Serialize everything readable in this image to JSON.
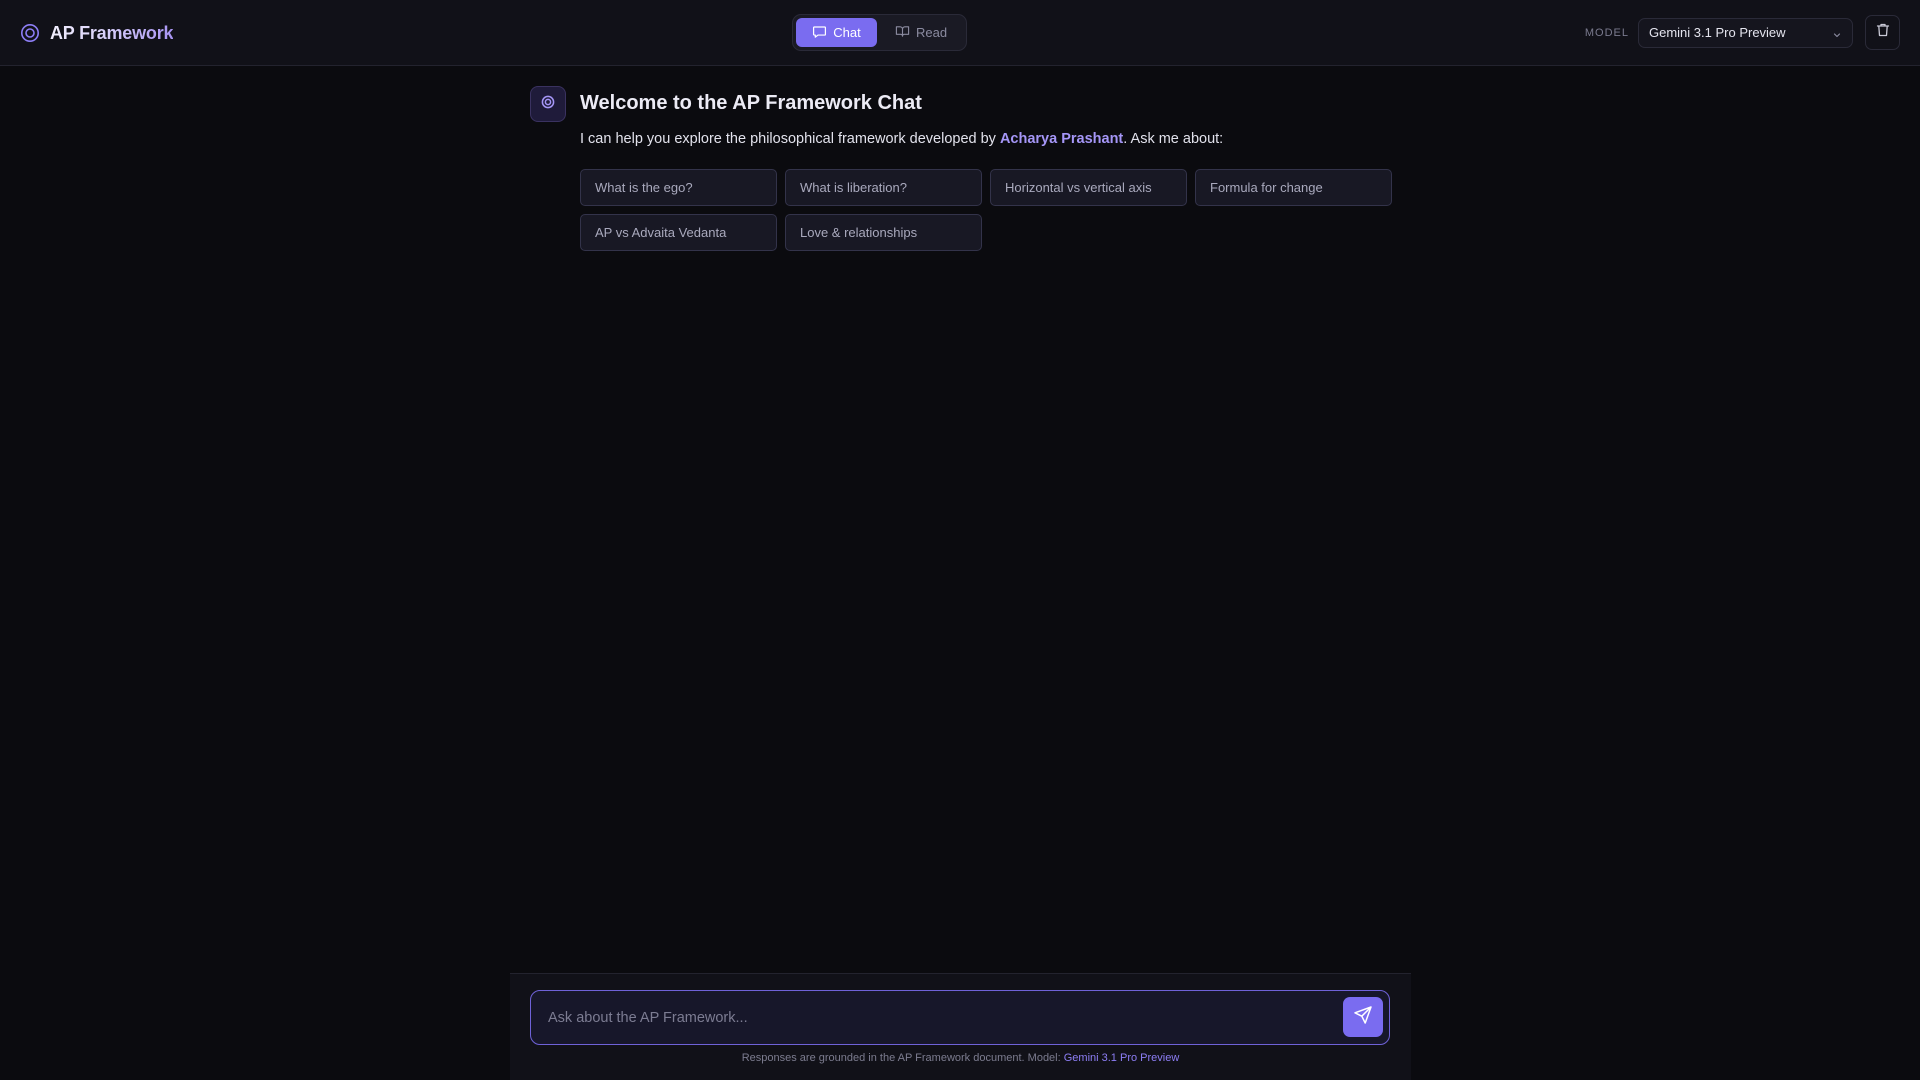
{
  "header": {
    "brand": {
      "title": "AP Framework",
      "icon": "target-circle-icon"
    },
    "mode_toggle": [
      {
        "label": "Chat",
        "icon": "chat-bubble-icon",
        "active": true
      },
      {
        "label": "Read",
        "icon": "book-open-icon",
        "active": false
      }
    ],
    "model_label": "MODEL",
    "model_select": {
      "value": "Gemini 3.1 Pro Preview",
      "icon": "chevron-down-icon"
    },
    "clear_button": {
      "icon": "trash-icon"
    }
  },
  "chat": {
    "avatar_icon": "target-circle-icon",
    "welcome_title": "Welcome to the AP Framework Chat",
    "intro_prefix": "I can help you explore the philosophical framework developed by ",
    "intro_author": "Acharya Prashant",
    "intro_suffix": ". Ask me about:",
    "suggestions": [
      "What is the ego?",
      "What is liberation?",
      "Horizontal vs vertical axis",
      "Formula for change",
      "AP vs Advaita Vedanta",
      "Love & relationships"
    ]
  },
  "composer": {
    "placeholder": "Ask about the AP Framework...",
    "value": "",
    "send_icon": "send-icon",
    "footnote_prefix": "Responses are grounded in the AP Framework document. Model: ",
    "footnote_model": "Gemini 3.1 Pro Preview"
  },
  "colors": {
    "accent": "#7a6cf0",
    "accent_text": "#a596f7",
    "background": "#0b0b0f",
    "panel": "#111118"
  }
}
